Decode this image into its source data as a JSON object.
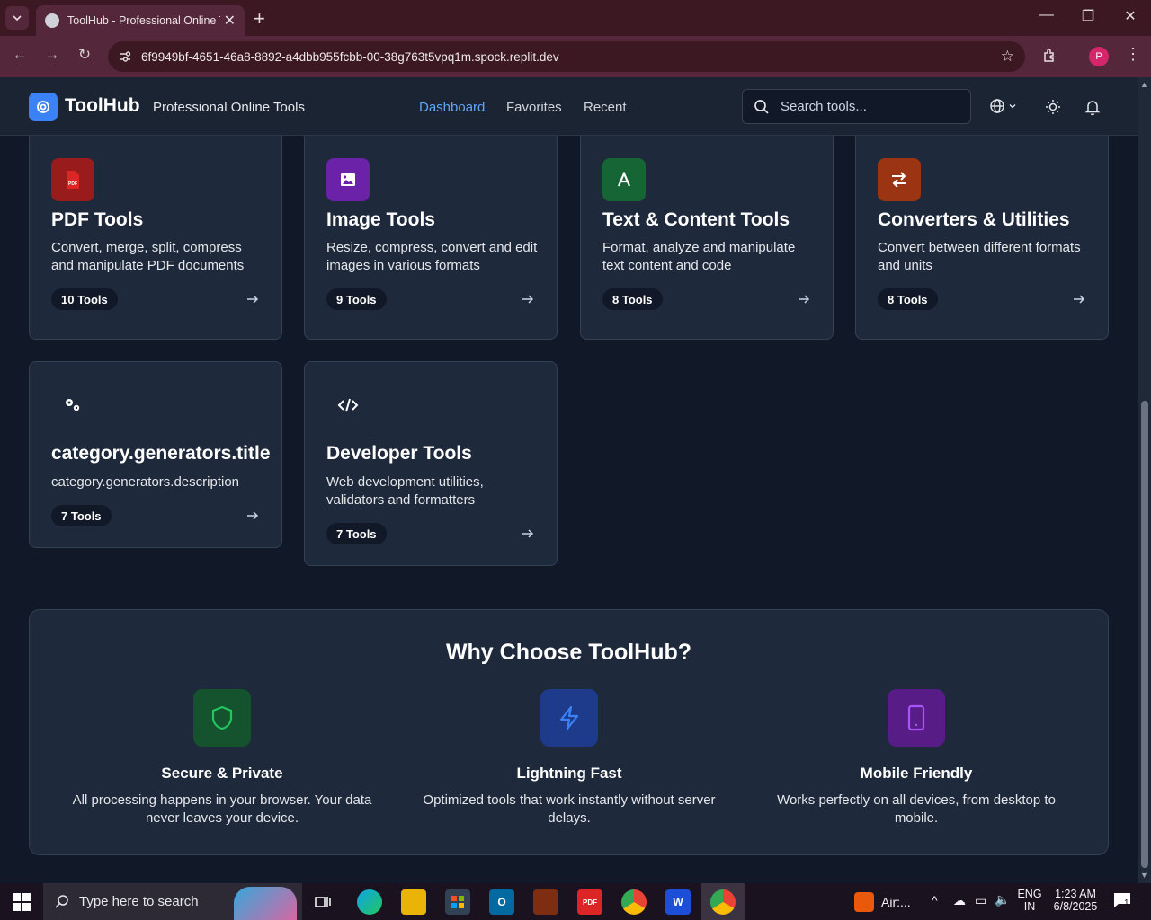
{
  "browser": {
    "tab_title": "ToolHub - Professional Online T",
    "url": "6f9949bf-4651-46a8-8892-a4dbb955fcbb-00-38g763t5vpq1m.spock.replit.dev",
    "profile_initial": "P"
  },
  "header": {
    "brand": "ToolHub",
    "tagline": "Professional Online Tools",
    "nav": [
      "Dashboard",
      "Favorites",
      "Recent"
    ],
    "search_placeholder": "Search tools..."
  },
  "categories": [
    {
      "title": "PDF Tools",
      "description": "Convert, merge, split, compress and manipulate PDF documents",
      "count": "10 Tools",
      "icon": "file-pdf-icon",
      "color": "#991b1b"
    },
    {
      "title": "Image Tools",
      "description": "Resize, compress, convert and edit images in various formats",
      "count": "9 Tools",
      "icon": "image-icon",
      "color": "#6b21a8"
    },
    {
      "title": "Text & Content Tools",
      "description": "Format, analyze and manipulate text content and code",
      "count": "8 Tools",
      "icon": "font-icon",
      "color": "#166534"
    },
    {
      "title": "Converters & Utilities",
      "description": "Convert between different formats and units",
      "count": "8 Tools",
      "icon": "exchange-icon",
      "color": "#9a3412"
    },
    {
      "title": "category.generators.title",
      "description": "category.generators.description",
      "count": "7 Tools",
      "icon": "cogs-icon",
      "color": "#1e293b"
    },
    {
      "title": "Developer Tools",
      "description": "Web development utilities, validators and formatters",
      "count": "7 Tools",
      "icon": "code-icon",
      "color": "#1e293b"
    }
  ],
  "why": {
    "title": "Why Choose ToolHub?",
    "features": [
      {
        "title": "Secure & Private",
        "description": "All processing happens in your browser. Your data never leaves your device.",
        "icon": "shield-icon",
        "color": "#14532d"
      },
      {
        "title": "Lightning Fast",
        "description": "Optimized tools that work instantly without server delays.",
        "icon": "lightning-icon",
        "color": "#1e3a8a"
      },
      {
        "title": "Mobile Friendly",
        "description": "Works perfectly on all devices, from desktop to mobile.",
        "icon": "tablet-icon",
        "color": "#581c87"
      }
    ]
  },
  "taskbar": {
    "search_placeholder": "Type here to search",
    "weather": "Air:...",
    "lang_top": "ENG",
    "lang_bottom": "IN",
    "time": "1:23 AM",
    "date": "6/8/2025",
    "notif_count": "1"
  }
}
